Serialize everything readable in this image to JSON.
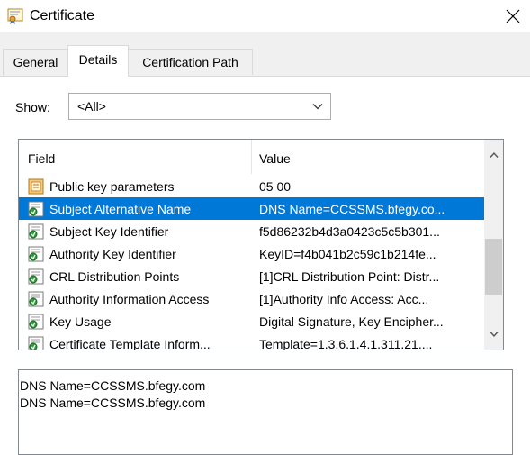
{
  "window": {
    "title": "Certificate"
  },
  "tabs": [
    {
      "label": "General",
      "active": false
    },
    {
      "label": "Details",
      "active": true
    },
    {
      "label": "Certification Path",
      "active": false
    }
  ],
  "show": {
    "label": "Show:",
    "value": "<All>"
  },
  "grid": {
    "columns": {
      "field": "Field",
      "value": "Value"
    },
    "rows": [
      {
        "field": "Public key parameters",
        "value": "05 00",
        "icon": "cert-prop-icon",
        "selected": false
      },
      {
        "field": "Subject Alternative Name",
        "value": "DNS Name=CCSSMS.bfegy.co...",
        "icon": "cert-extension-icon",
        "selected": true
      },
      {
        "field": "Subject Key Identifier",
        "value": "f5d86232b4d3a0423c5c5b301...",
        "icon": "cert-extension-icon",
        "selected": false
      },
      {
        "field": "Authority Key Identifier",
        "value": "KeyID=f4b041b2c59c1b214fe...",
        "icon": "cert-extension-icon",
        "selected": false
      },
      {
        "field": "CRL Distribution Points",
        "value": "[1]CRL Distribution Point: Distr...",
        "icon": "cert-extension-icon",
        "selected": false
      },
      {
        "field": "Authority Information Access",
        "value": "[1]Authority Info Access: Acc...",
        "icon": "cert-extension-icon",
        "selected": false
      },
      {
        "field": "Key Usage",
        "value": "Digital Signature, Key Encipher...",
        "icon": "cert-extension-icon",
        "selected": false
      },
      {
        "field": "Certificate Template Inform...",
        "value": "Template=1.3.6.1.4.1.311.21....",
        "icon": "cert-extension-icon",
        "selected": false
      }
    ]
  },
  "detail": {
    "lines": [
      "DNS Name=CCSSMS.bfegy.com",
      "DNS Name=CCSSMS.bfegy.com"
    ]
  },
  "colors": {
    "selection": "#0078d7",
    "tab_bg": "#f0f0f0",
    "border": "#828790"
  }
}
